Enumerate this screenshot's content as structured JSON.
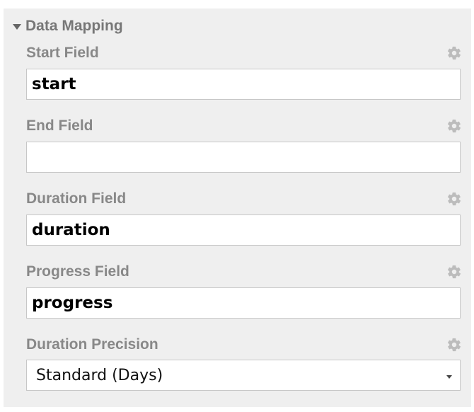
{
  "section": {
    "title": "Data Mapping"
  },
  "fields": {
    "start": {
      "label": "Start Field",
      "value": "start"
    },
    "end": {
      "label": "End Field",
      "value": ""
    },
    "duration": {
      "label": "Duration Field",
      "value": "duration"
    },
    "progress": {
      "label": "Progress Field",
      "value": "progress"
    },
    "precision": {
      "label": "Duration Precision",
      "value": "Standard (Days)"
    }
  },
  "icons": {
    "collapse": "caret-down-icon",
    "settings": "gear-icon",
    "dropdown": "chevron-down-icon"
  },
  "colors": {
    "panel_background": "#efefef",
    "label_text": "#888888",
    "header_text": "#777777",
    "gear_icon": "#bcbcbc",
    "input_border": "#c7c7c7"
  }
}
